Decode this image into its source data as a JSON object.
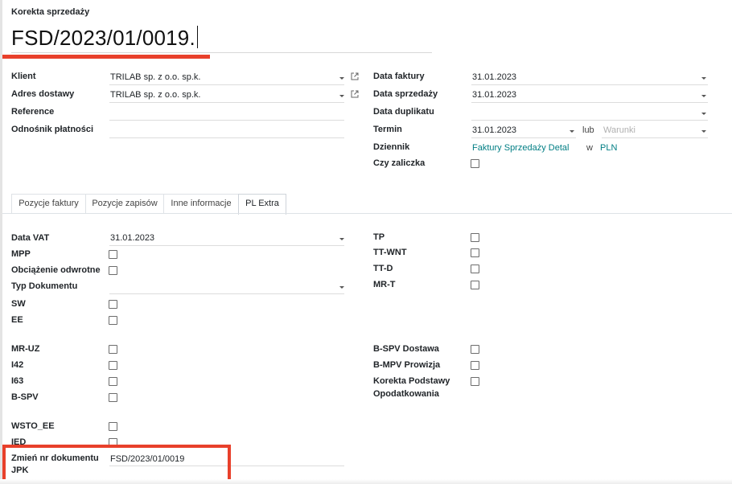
{
  "header": {
    "doc_type": "Korekta sprzedaży",
    "doc_name": "FSD/2023/01/0019."
  },
  "left_fields": {
    "klient": {
      "label": "Klient",
      "value": "TRILAB sp. z o.o. sp.k."
    },
    "adres": {
      "label": "Adres dostawy",
      "value": "TRILAB sp. z o.o. sp.k."
    },
    "reference": {
      "label": "Reference",
      "value": ""
    },
    "odnosnik": {
      "label": "Odnośnik płatności",
      "value": ""
    }
  },
  "right_fields": {
    "data_faktury": {
      "label": "Data faktury",
      "value": "31.01.2023"
    },
    "data_sprzedazy": {
      "label": "Data sprzedaży",
      "value": "31.01.2023"
    },
    "data_duplikatu": {
      "label": "Data duplikatu",
      "value": ""
    },
    "termin": {
      "label": "Termin",
      "value": "31.01.2023",
      "lub": "lub",
      "warunki_placeholder": "Warunki"
    },
    "dziennik": {
      "label": "Dziennik",
      "value": "Faktury Sprzedaży Detal",
      "w": "w",
      "currency": "PLN"
    },
    "czy_zaliczka": {
      "label": "Czy zaliczka",
      "checked": false
    }
  },
  "tabs": [
    {
      "label": "Pozycje faktury",
      "active": false
    },
    {
      "label": "Pozycje zapisów",
      "active": false
    },
    {
      "label": "Inne informacje",
      "active": false
    },
    {
      "label": "PL Extra",
      "active": true
    }
  ],
  "pl_extra_left": {
    "data_vat": {
      "label": "Data VAT",
      "value": "31.01.2023"
    },
    "mpp": {
      "label": "MPP",
      "checked": false
    },
    "obciazenie": {
      "label": "Obciążenie odwrotne",
      "checked": false
    },
    "typ_dokumentu": {
      "label": "Typ Dokumentu",
      "value": ""
    },
    "sw": {
      "label": "SW",
      "checked": false
    },
    "ee": {
      "label": "EE",
      "checked": false
    },
    "mr_uz": {
      "label": "MR-UZ",
      "checked": false
    },
    "i42": {
      "label": "I42",
      "checked": false
    },
    "i63": {
      "label": "I63",
      "checked": false
    },
    "b_spv": {
      "label": "B-SPV",
      "checked": false
    },
    "wsto_ee": {
      "label": "WSTO_EE",
      "checked": false
    },
    "ied": {
      "label": "IED",
      "checked": false
    },
    "zmien_nr": {
      "label_line1": "Zmień nr dokumentu",
      "label_line2": "JPK",
      "value": "FSD/2023/01/0019"
    }
  },
  "pl_extra_right": {
    "tp": {
      "label": "TP",
      "checked": false
    },
    "tt_wnt": {
      "label": "TT-WNT",
      "checked": false
    },
    "tt_d": {
      "label": "TT-D",
      "checked": false
    },
    "mr_t": {
      "label": "MR-T",
      "checked": false
    },
    "b_spv_dostawa": {
      "label": "B-SPV Dostawa",
      "checked": false
    },
    "b_mpv_prowizja": {
      "label": "B-MPV Prowizja",
      "checked": false
    },
    "korekta": {
      "label_line1": "Korekta Podstawy",
      "label_line2": "Opodatkowania",
      "checked": false
    }
  },
  "colors": {
    "accent_red": "#e8402b",
    "link": "#017e84"
  }
}
